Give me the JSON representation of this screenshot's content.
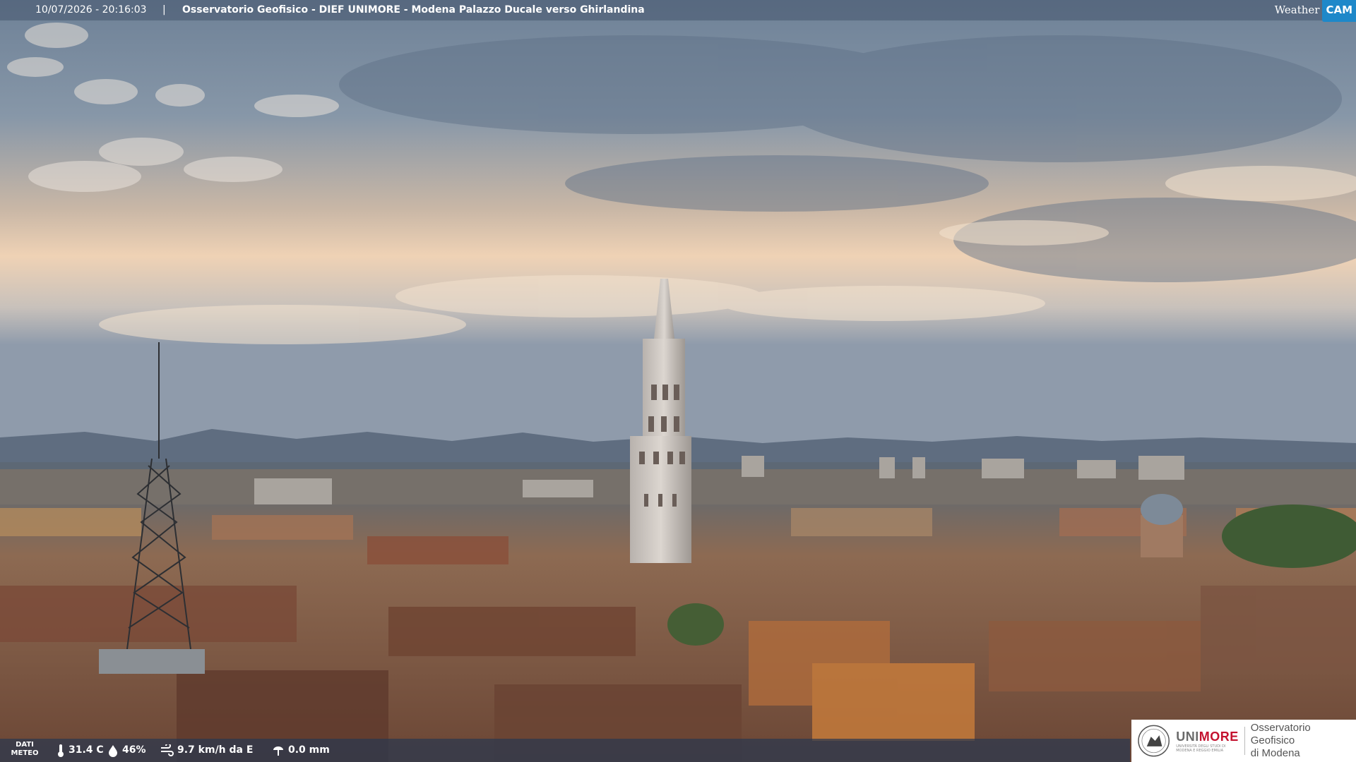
{
  "camera": {
    "timestamp": "10/07/2026 - 20:16:03",
    "separator": "|",
    "title": "Osservatorio Geofisico - DIEF UNIMORE - Modena Palazzo Ducale verso Ghirlandina",
    "brand_weather": "Weather",
    "brand_cam": "CAM"
  },
  "meteo": {
    "label_line1": "DATI",
    "label_line2": "METEO",
    "temperature": "31.4 C",
    "humidity": "46%",
    "wind": "9.7 km/h da E",
    "rain": "0.0 mm"
  },
  "institution": {
    "name_part1": "UNI",
    "name_part2": "MORE",
    "subtitle": "UNIVERSITÀ DEGLI STUDI DI MODENA E REGGIO EMILIA",
    "observatory_line1": "Osservatorio Geofisico",
    "observatory_line2": "di Modena"
  },
  "colors": {
    "sky_top": "#6f8196",
    "sky_glow": "#f2d3b2",
    "mountains": "#5d6b7e",
    "roofs": "#9a6a4e",
    "brand_red": "#c4122f",
    "brand_blue": "#1e88c9"
  }
}
